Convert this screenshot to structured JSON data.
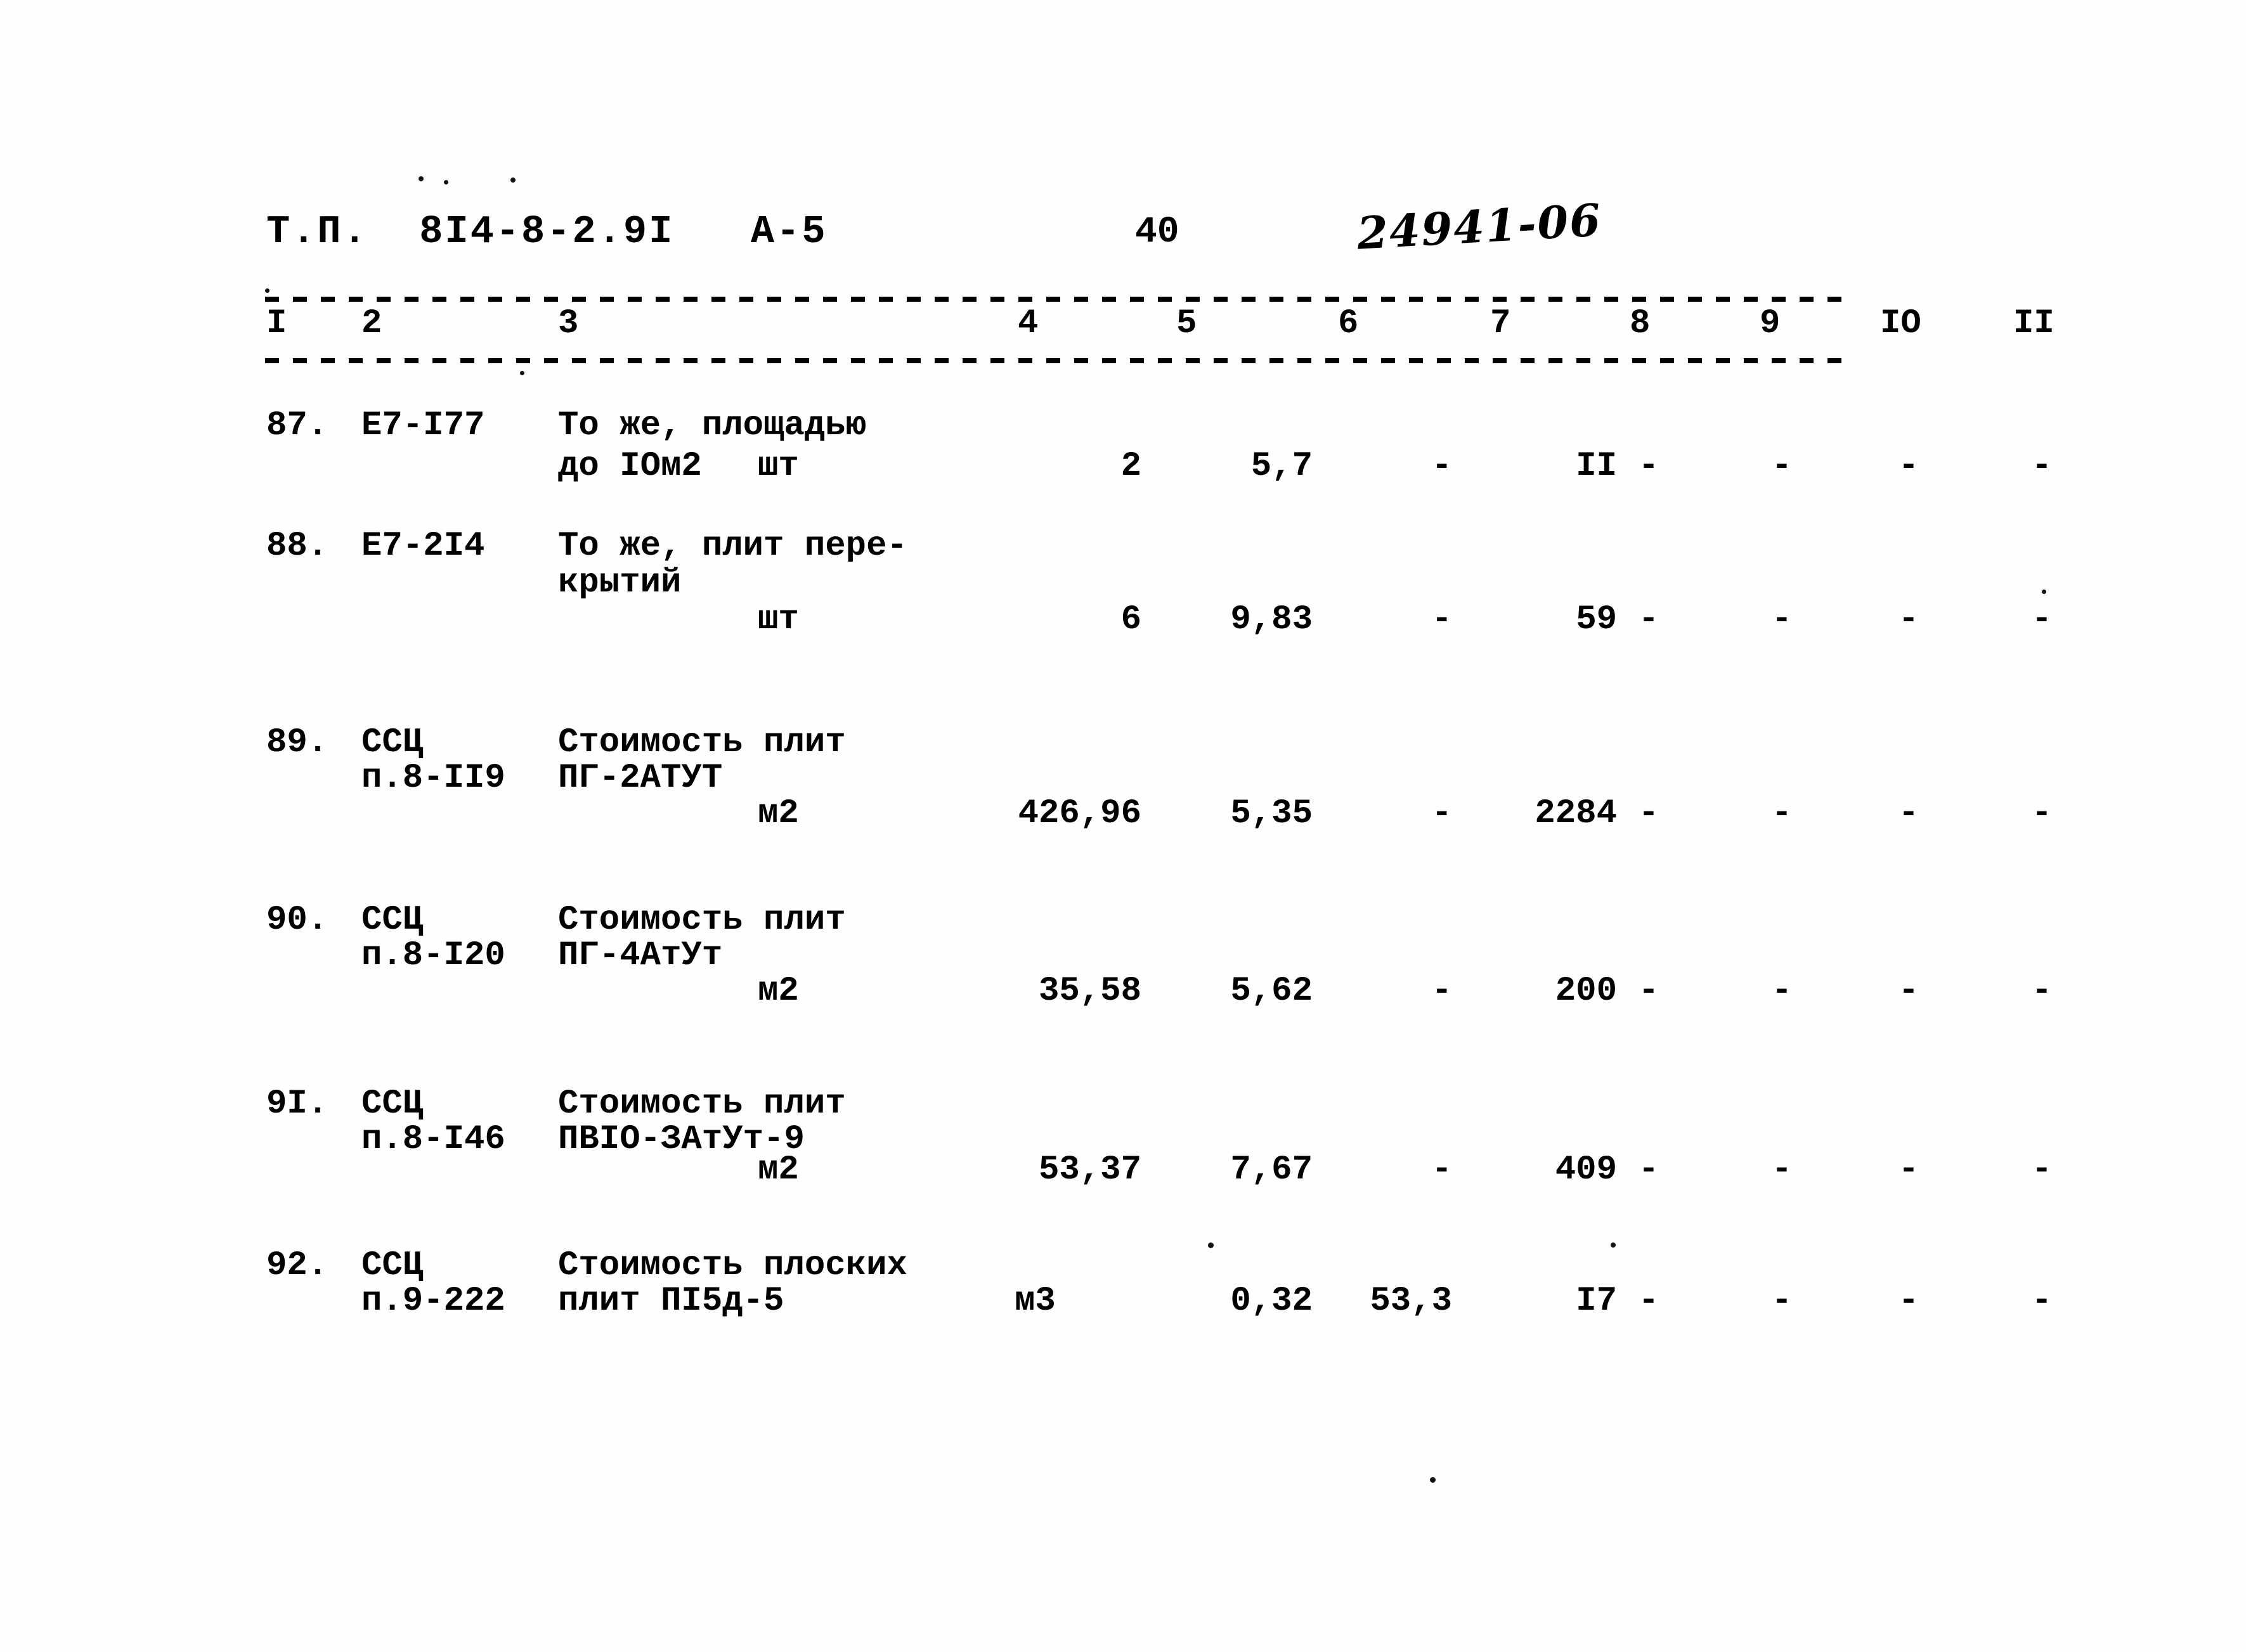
{
  "header": {
    "document_code": "Т.П.  8I4-8-2.9I   А-5",
    "page_number": "40",
    "handwritten_code": "24941-06"
  },
  "table": {
    "column_headers": [
      "I",
      "2",
      "3",
      "4",
      "5",
      "6",
      "7",
      "8",
      "9",
      "IO",
      "II"
    ],
    "rows": [
      {
        "num": "87.",
        "code": [
          "Е7-I77"
        ],
        "desc": [
          "То же, площадью",
          "до IOм2"
        ],
        "unit": "шт",
        "qty": "2",
        "v5": "5,7",
        "v6": "-",
        "v7": "II",
        "v8": "-",
        "v9": "-",
        "v10": "-",
        "v11": "-"
      },
      {
        "num": "88.",
        "code": [
          "Е7-2I4"
        ],
        "desc": [
          "То же, плит пере-",
          "крытий"
        ],
        "unit": "шт",
        "qty": "6",
        "v5": "9,83",
        "v6": "-",
        "v7": "59",
        "v8": "-",
        "v9": "-",
        "v10": "-",
        "v11": "-"
      },
      {
        "num": "89.",
        "code": [
          "ССЦ",
          "п.8-II9"
        ],
        "desc": [
          "Стоимость плит",
          "ПГ-2АТУТ"
        ],
        "unit": "м2",
        "qty": "426,96",
        "v5": "5,35",
        "v6": "-",
        "v7": "2284",
        "v8": "-",
        "v9": "-",
        "v10": "-",
        "v11": "-"
      },
      {
        "num": "90.",
        "code": [
          "ССЦ",
          "п.8-I20"
        ],
        "desc": [
          "Стоимость плит",
          "ПГ-4АтУт"
        ],
        "unit": "м2",
        "qty": "35,58",
        "v5": "5,62",
        "v6": "-",
        "v7": "200",
        "v8": "-",
        "v9": "-",
        "v10": "-",
        "v11": "-"
      },
      {
        "num": "9I.",
        "code": [
          "ССЦ",
          "п.8-I46"
        ],
        "desc": [
          "Стоимость плит",
          "ПВIO-ЗАтУт-9"
        ],
        "unit": "м2",
        "qty": "53,37",
        "v5": "7,67",
        "v6": "-",
        "v7": "409",
        "v8": "-",
        "v9": "-",
        "v10": "-",
        "v11": "-"
      },
      {
        "num": "92.",
        "code": [
          "ССЦ",
          "п.9-222"
        ],
        "desc": [
          "Стоимость плоских",
          "плит ПI5д-5"
        ],
        "unit": "м3",
        "qty": "",
        "v5": "0,32",
        "v6": "53,3",
        "v7": "I7",
        "v8": "-",
        "v9": "-",
        "v10": "-",
        "v11": "-"
      }
    ]
  }
}
